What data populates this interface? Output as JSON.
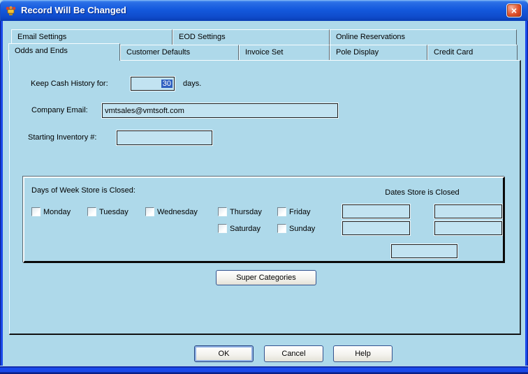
{
  "window": {
    "title": "Record Will Be Changed",
    "close_glyph": "×"
  },
  "tabs_row1": [
    {
      "label": "Email Settings"
    },
    {
      "label": "EOD Settings"
    },
    {
      "label": "Online Reservations"
    }
  ],
  "tabs_row2": [
    {
      "label": "Odds and Ends",
      "active": true
    },
    {
      "label": "Customer Defaults"
    },
    {
      "label": "Invoice Set"
    },
    {
      "label": "Pole Display"
    },
    {
      "label": "Credit Card"
    }
  ],
  "form": {
    "cash_history": {
      "label": "Keep Cash History for:",
      "value": "30",
      "suffix": "days."
    },
    "company_email": {
      "label": "Company Email:",
      "value": "vmtsales@vmtsoft.com"
    },
    "starting_inventory": {
      "label": "Starting Inventory #:",
      "value": ""
    }
  },
  "closed_panel": {
    "days_label": "Days of Week Store is Closed:",
    "dates_label": "Dates Store is Closed",
    "weekdays_row1": [
      "Monday",
      "Tuesday",
      "Wednesday",
      "Thursday",
      "Friday"
    ],
    "weekdays_row2": [
      "Saturday",
      "Sunday"
    ],
    "date_fields": [
      "",
      "",
      "",
      "",
      ""
    ]
  },
  "buttons": {
    "super_categories": "Super Categories",
    "ok": "OK",
    "cancel": "Cancel",
    "help": "Help"
  },
  "colors": {
    "dialog_bg": "#aed9ea",
    "field_bg": "#c2e3f1",
    "selection_bg": "#2e5fc0",
    "titlebar_blue": "#1459dd",
    "window_border_blue": "#1a49ea",
    "close_red": "#e0502a"
  }
}
